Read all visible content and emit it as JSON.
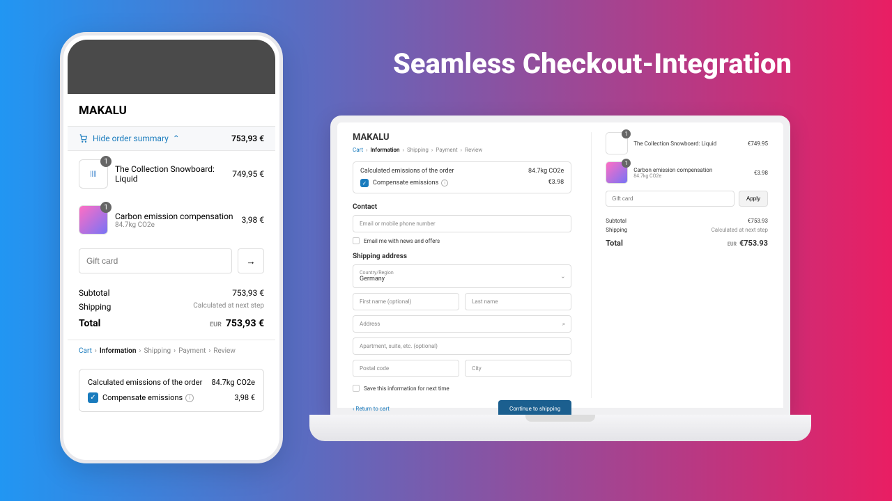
{
  "headline": "Seamless Checkout-Integration",
  "store": "MAKALU",
  "currency": "EUR",
  "mobile": {
    "summary_toggle": "Hide order summary",
    "summary_price": "753,93 €",
    "items": [
      {
        "name": "The Collection Snowboard: Liquid",
        "sub": "",
        "qty": "1",
        "price": "749,95 €"
      },
      {
        "name": "Carbon emission compensation",
        "sub": "84.7kg CO2e",
        "qty": "1",
        "price": "3,98 €"
      }
    ],
    "gift_placeholder": "Gift card",
    "subtotal_label": "Subtotal",
    "subtotal": "753,93 €",
    "shipping_label": "Shipping",
    "shipping_value": "Calculated at next step",
    "total_label": "Total",
    "total": "753,93 €",
    "breadcrumb": [
      "Cart",
      "Information",
      "Shipping",
      "Payment",
      "Review"
    ],
    "emissions": {
      "title": "Calculated emissions of the order",
      "value": "84.7kg CO2e",
      "checkbox": "Compensate emissions",
      "price": "3,98 €"
    }
  },
  "desktop": {
    "breadcrumb": [
      "Cart",
      "Information",
      "Shipping",
      "Payment",
      "Review"
    ],
    "emissions": {
      "title": "Calculated emissions of the order",
      "value": "84.7kg CO2e",
      "checkbox": "Compensate emissions",
      "price": "€3.98"
    },
    "contact_heading": "Contact",
    "contact_placeholder": "Email or mobile phone number",
    "newsletter": "Email me with news and offers",
    "shipping_heading": "Shipping address",
    "country_label": "Country/Region",
    "country_value": "Germany",
    "firstname": "First name (optional)",
    "lastname": "Last name",
    "address": "Address",
    "apt": "Apartment, suite, etc. (optional)",
    "postal": "Postal code",
    "city": "City",
    "save_info": "Save this information for next time",
    "return": "Return to cart",
    "continue": "Continue to shipping",
    "sidebar": {
      "items": [
        {
          "name": "The Collection Snowboard: Liquid",
          "sub": "",
          "qty": "1",
          "price": "€749.95"
        },
        {
          "name": "Carbon emission compensation",
          "sub": "84.7kg CO2e",
          "qty": "1",
          "price": "€3.98"
        }
      ],
      "gift_placeholder": "Gift card",
      "apply": "Apply",
      "subtotal_label": "Subtotal",
      "subtotal": "€753.93",
      "shipping_label": "Shipping",
      "shipping_value": "Calculated at next step",
      "total_label": "Total",
      "total": "€753.93"
    }
  }
}
